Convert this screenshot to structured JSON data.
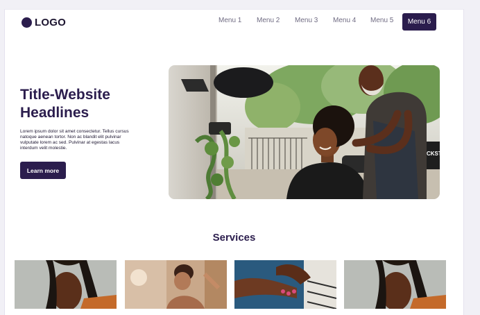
{
  "nav": {
    "logo_text": "LOGO",
    "menu": [
      "Menu 1",
      "Menu 2",
      "Menu 3",
      "Menu 4",
      "Menu 5",
      "Menu 6"
    ],
    "active_menu_label": "Menu 6"
  },
  "hero": {
    "title_line1": "Title-Website",
    "title_line2": "Headlines",
    "description": "Lorem ipsum dolor sit amet consectetur. Tellus cursus natoque aenean tortor. Non ac blandit elit pulvinar vulputate lorem ac sed. Pulvinar at egestas lacus interdum velit molestie.",
    "button_label": "Learn more",
    "image": "salon-hairdresser-photo",
    "sign_text": "CKST"
  },
  "services": {
    "title": "Services",
    "cards": [
      "braids-portrait-photo",
      "spa-massage-photo",
      "manicure-photo",
      "braids-portrait-photo"
    ]
  },
  "colors": {
    "brand": "#2b1d4d",
    "page_bg": "#ffffff",
    "menu_text": "#6f6b82"
  }
}
